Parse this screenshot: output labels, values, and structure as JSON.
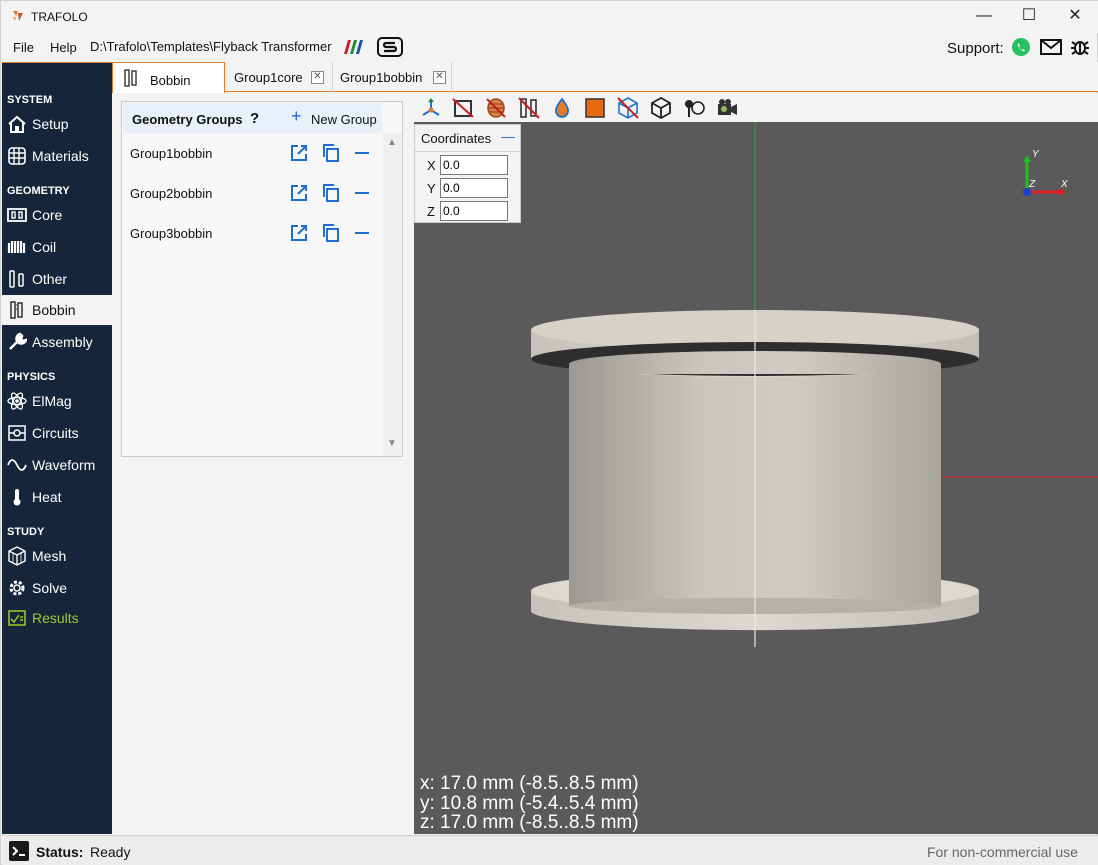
{
  "app": {
    "title": "TRAFOLO"
  },
  "menu": {
    "file": "File",
    "help": "Help",
    "path": "D:\\Trafolo\\Templates\\Flyback Transformer",
    "support": "Support:"
  },
  "window_controls": {
    "minimize": "—",
    "maximize": "☐",
    "close": "✕"
  },
  "sidebar": {
    "sections": {
      "system": "SYSTEM",
      "geometry": "GEOMETRY",
      "physics": "PHYSICS",
      "study": "STUDY"
    },
    "items": {
      "setup": "Setup",
      "materials": "Materials",
      "core": "Core",
      "coil": "Coil",
      "other": "Other",
      "bobbin": "Bobbin",
      "assembly": "Assembly",
      "elmag": "ElMag",
      "circuits": "Circuits",
      "waveform": "Waveform",
      "heat": "Heat",
      "mesh": "Mesh",
      "solve": "Solve",
      "results": "Results"
    }
  },
  "tabs": [
    {
      "label": "Bobbin"
    },
    {
      "label": "Group1core"
    },
    {
      "label": "Group1bobbin"
    }
  ],
  "geometry_groups": {
    "title": "Geometry Groups",
    "help": "?",
    "new_group": "New Group",
    "groups": [
      "Group1bobbin",
      "Group2bobbin",
      "Group3bobbin"
    ]
  },
  "coordinates": {
    "title": "Coordinates",
    "collapse": "—",
    "x_label": "X",
    "y_label": "Y",
    "z_label": "Z",
    "x": "0.0",
    "y": "0.0",
    "z": "0.0"
  },
  "axes": {
    "x": "X",
    "y": "Y",
    "z": "Z"
  },
  "dimensions": {
    "x": "x:  17.0 mm (-8.5..8.5 mm)",
    "y": "y:  10.8 mm (-5.4..5.4 mm)",
    "z": "z:  17.0 mm (-8.5..8.5 mm)"
  },
  "status": {
    "label": "Status:",
    "value": "Ready",
    "license": "For non-commercial use"
  },
  "colors": {
    "sidebar": "#15253a",
    "accent": "#e07b2a",
    "viewport": "#5a5a5a",
    "icon_blue": "#1f6fd1",
    "results_green": "#9ccc2f"
  }
}
